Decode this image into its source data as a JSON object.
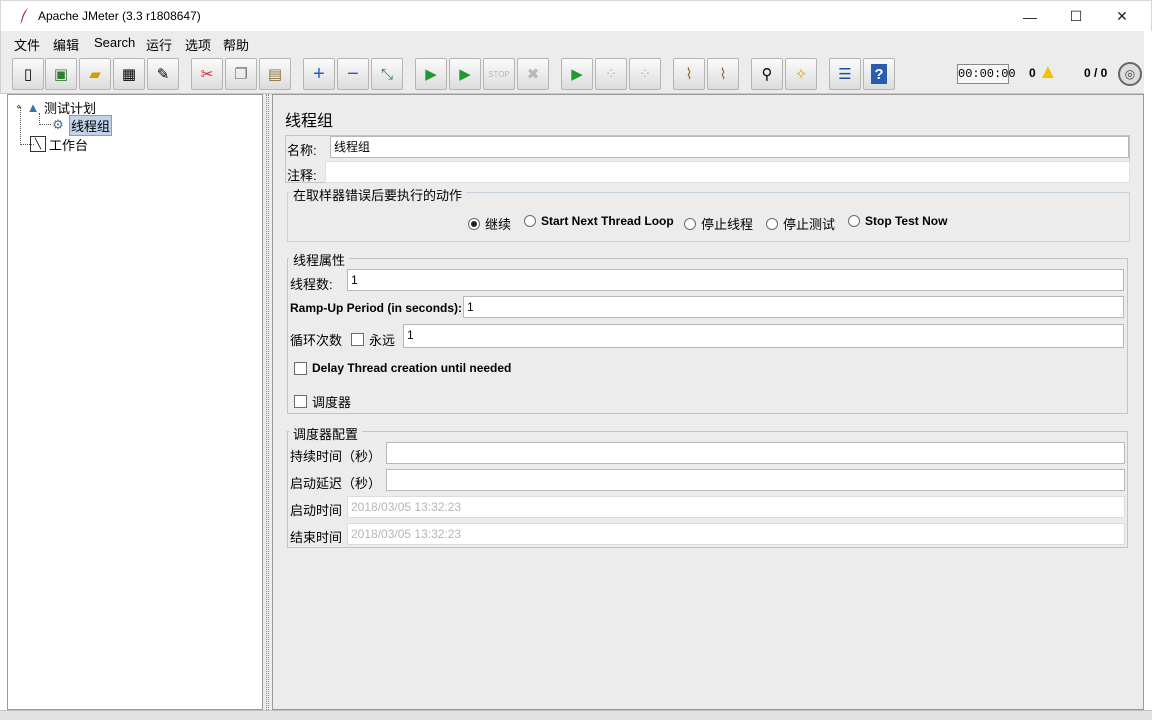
{
  "window": {
    "title": "Apache JMeter (3.3 r1808647)",
    "minimize_glyph": "—",
    "maximize_glyph": "☐",
    "close_glyph": "✕"
  },
  "menu": {
    "items": [
      "文件",
      "编辑",
      "Search",
      "运行",
      "选项",
      "帮助"
    ]
  },
  "toolbar": {
    "buttons": [
      {
        "icon": "new-icon",
        "glyph": "▯"
      },
      {
        "icon": "templates-icon",
        "glyph": "▣"
      },
      {
        "icon": "open-icon",
        "glyph": "▰"
      },
      {
        "icon": "save-icon",
        "glyph": "▦"
      },
      {
        "icon": "save-as-icon",
        "glyph": "✎"
      },
      {
        "icon": "cut-icon",
        "glyph": "✂"
      },
      {
        "icon": "copy-icon",
        "glyph": "❐"
      },
      {
        "icon": "paste-icon",
        "glyph": "▤"
      },
      {
        "icon": "expand-icon",
        "glyph": "+"
      },
      {
        "icon": "collapse-icon",
        "glyph": "−"
      },
      {
        "icon": "toggle-icon",
        "glyph": "⤡"
      },
      {
        "icon": "start-icon",
        "glyph": "▶"
      },
      {
        "icon": "start-no-pause-icon",
        "glyph": "▶"
      },
      {
        "icon": "stop-icon",
        "glyph": "STOP"
      },
      {
        "icon": "shutdown-icon",
        "glyph": "✖"
      },
      {
        "icon": "remote-start-icon",
        "glyph": "▶"
      },
      {
        "icon": "remote-stop-icon",
        "glyph": "⁘"
      },
      {
        "icon": "remote-shutdown-icon",
        "glyph": "⁘"
      },
      {
        "icon": "clear-icon",
        "glyph": "⌇"
      },
      {
        "icon": "clear-all-icon",
        "glyph": "⌇"
      },
      {
        "icon": "search-icon",
        "glyph": "⚲"
      },
      {
        "icon": "reset-search-icon",
        "glyph": "✧"
      },
      {
        "icon": "function-helper-icon",
        "glyph": "☰"
      },
      {
        "icon": "help-icon",
        "glyph": "?"
      }
    ],
    "timer": "00:00:00",
    "error_count": "0",
    "thread_count": "0 / 0"
  },
  "tree": {
    "root": "测试计划",
    "child": "线程组",
    "workbench": "工作台"
  },
  "panel": {
    "title": "线程组",
    "name_label": "名称:",
    "name_value": "线程组",
    "comment_label": "注释:",
    "comment_value": "",
    "error_action": {
      "legend": "在取样器错误后要执行的动作",
      "options": [
        {
          "label": "继续",
          "selected": true
        },
        {
          "label": "Start Next Thread Loop",
          "selected": false
        },
        {
          "label": "停止线程",
          "selected": false
        },
        {
          "label": "停止测试",
          "selected": false
        },
        {
          "label": "Stop Test Now",
          "selected": false
        }
      ]
    },
    "thread_props": {
      "legend": "线程属性",
      "threads_label": "线程数:",
      "threads_value": "1",
      "rampup_label": "Ramp-Up Period (in seconds):",
      "rampup_value": "1",
      "loop_label": "循环次数",
      "forever_label": "永远",
      "loop_value": "1",
      "delay_label": "Delay Thread creation until needed",
      "scheduler_label": "调度器"
    },
    "scheduler": {
      "legend": "调度器配置",
      "duration_label": "持续时间（秒）",
      "duration_value": "",
      "delay_label": "启动延迟（秒）",
      "delay_value": "",
      "start_label": "启动时间",
      "start_value": "2018/03/05 13:32:23",
      "end_label": "结束时间",
      "end_value": "2018/03/05 13:32:23"
    }
  }
}
